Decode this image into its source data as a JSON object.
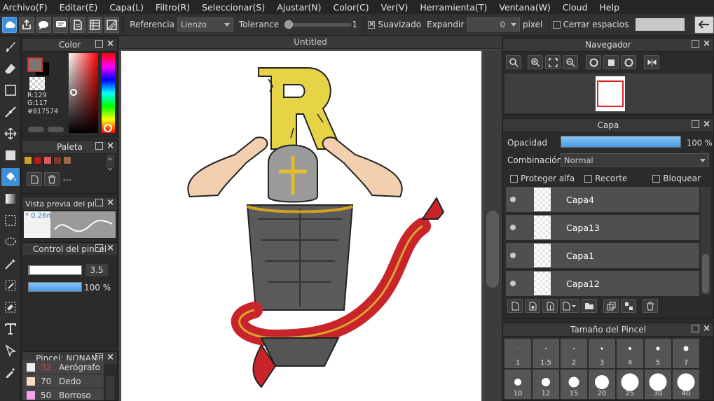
{
  "menu": [
    "Archivo(F)",
    "Editar(E)",
    "Capa(L)",
    "Filtro(R)",
    "Seleccionar(S)",
    "Ajustar(N)",
    "Color(C)",
    "Ver(V)",
    "Herramienta(T)",
    "Ventana(W)",
    "Cloud",
    "Help"
  ],
  "toolbar": {
    "reference_label": "Referencia",
    "reference_value": "Lienzo",
    "tolerance_label": "Tolerance",
    "tolerance_value": "1",
    "tolerance_fraction": 0.0,
    "smooth_label": "Suavizado",
    "smooth_checked": true,
    "expand_label": "Expandir",
    "expand_value": "0",
    "expand_unit": "pixel",
    "close_gaps_label": "Cerrar espacios",
    "close_gaps_checked": false
  },
  "color_panel": {
    "title": "Color",
    "r": "R:129",
    "g": "G:117",
    "hex": "#817574",
    "fg_color": "#817574",
    "bg_color": "#000000"
  },
  "palette_panel": {
    "title": "Paleta",
    "swatches": [
      "#c9a227",
      "#b51d1d",
      "#d85c5c",
      "#7a3b2e",
      "#9c6a4a"
    ],
    "label": "---"
  },
  "stroke_preview": {
    "title": "Vista previa del pi...",
    "size": "* 0.26m"
  },
  "brush_control": {
    "title": "Control del pincel",
    "size_value": "3.5",
    "size_fraction": 0.03,
    "opacity_value": "100 %",
    "opacity_fraction": 1.0
  },
  "brush_list": {
    "title": "Pincel: NONAME",
    "items": [
      {
        "size": "32",
        "name": "Aerógrafo",
        "color": "#eeeeee"
      },
      {
        "size": "70",
        "name": "Dedo",
        "color": "#ffd9c2"
      },
      {
        "size": "50",
        "name": "Borroso",
        "color": "#f6a4ee"
      }
    ]
  },
  "canvas": {
    "tab_title": "Untitled"
  },
  "navigator": {
    "title": "Navegador"
  },
  "layers": {
    "title": "Capa",
    "opacity_label": "Opacidad",
    "opacity_value": "100 %",
    "opacity_fraction": 1.0,
    "blend_label": "Combinación",
    "blend_value": "Normal",
    "protect_alpha": "Proteger alfa",
    "clipping": "Recorte",
    "lock": "Bloquear",
    "items": [
      {
        "name": "Capa4"
      },
      {
        "name": "Capa13"
      },
      {
        "name": "Capa1"
      },
      {
        "name": "Capa12"
      }
    ]
  },
  "brush_size": {
    "title": "Tamaño del Pincel",
    "row1": [
      "1",
      "1.5",
      "2",
      "3",
      "4",
      "5",
      "7"
    ],
    "row2": [
      "10",
      "12",
      "15",
      "20",
      "25",
      "30",
      "40"
    ]
  }
}
